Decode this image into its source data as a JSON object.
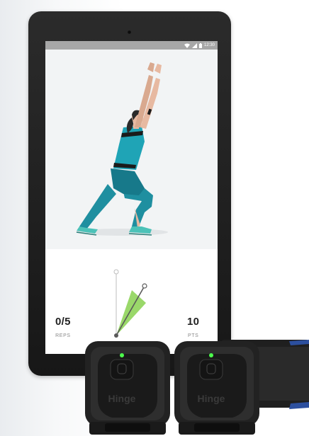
{
  "statusbar": {
    "time": "12:30",
    "icons": [
      "wifi-icon",
      "signal-icon",
      "battery-icon"
    ]
  },
  "exercise": {
    "illustration": "lunge-stretch-figure",
    "reps": {
      "value": "0/5",
      "label": "REPS"
    },
    "points": {
      "value": "10",
      "label": "PTS"
    }
  },
  "sensors": [
    {
      "brand": "Hinge",
      "led": "#4cff4c"
    },
    {
      "brand": "Hinge",
      "led": "#4cff4c"
    }
  ],
  "colors": {
    "accent_green": "#8fd45a",
    "figure_teal": "#1f8fa0",
    "figure_skin": "#e7b9a1",
    "tablet_body": "#222222",
    "strap_blue": "#2c4f9e"
  }
}
